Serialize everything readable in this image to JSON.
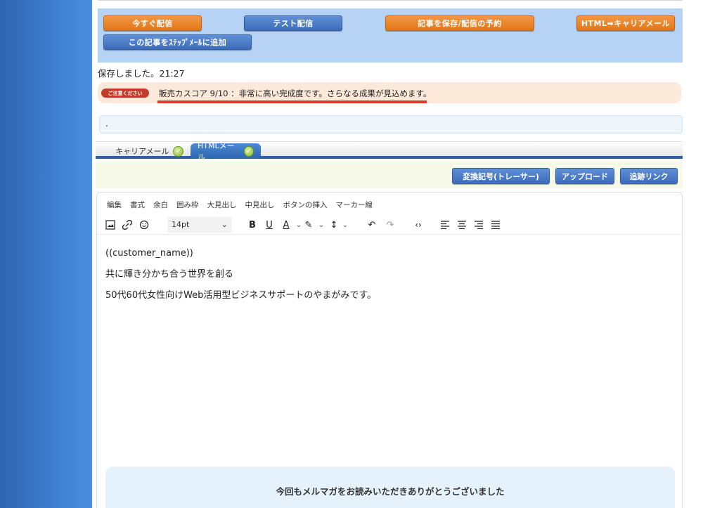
{
  "actions": {
    "send_now": "今すぐ配信",
    "test_send": "テスト配信",
    "save_schedule": "記事を保存/配信の予約",
    "html_to_carrier": "HTML➡キャリアメール",
    "add_to_step": "この記事をｽﾃｯﾌﾟﾒｰﾙに追加"
  },
  "status": {
    "saved": "保存しました。21:27"
  },
  "notice": {
    "badge": "ご注意ください",
    "text": "販売カスコア 9/10 ：非常に高い完成度です。さらなる成果が見込めます。"
  },
  "dotbox": {
    "value": "."
  },
  "tabs": {
    "carrier": "キャリアメール",
    "html": "HTMLメール"
  },
  "tools": {
    "tracer": "変換記号(トレーサー)",
    "upload": "アップロード",
    "tracking": "追跡リンク"
  },
  "editor": {
    "menu": [
      "編集",
      "書式",
      "余白",
      "囲み枠",
      "大見出し",
      "中見出し",
      "ボタンの挿入",
      "マーカー線"
    ],
    "font_size": "14pt",
    "body": {
      "line1": "((customer_name))",
      "line2": "共に輝き分かち合う世界を創る",
      "line3": "50代60代女性向けWeb活用型ビジネスサポートのやまがみです。"
    },
    "footer": "今回もメルマガをお読みいただきありがとうございました"
  },
  "colors": {
    "sidebar": "#3f7fd0",
    "accent_orange": "#e27618",
    "accent_blue": "#3e6cba",
    "notice_line": "#e03c2b"
  }
}
